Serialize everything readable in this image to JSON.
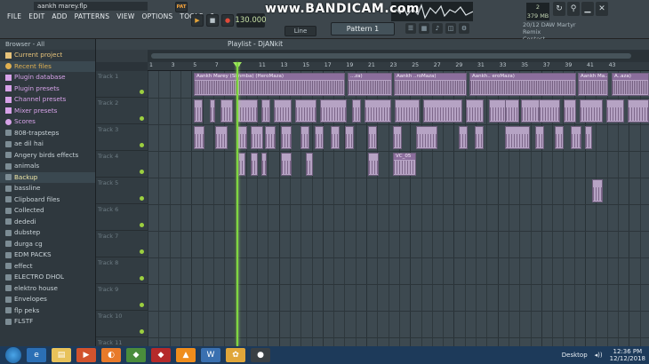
{
  "window": {
    "title": "aankh marey.flp"
  },
  "menu": [
    "FILE",
    "EDIT",
    "ADD",
    "PATTERNS",
    "VIEW",
    "OPTIONS",
    "TOOLS",
    "?"
  ],
  "transport": {
    "pattern_mode": "PAT",
    "tempo": "130.000",
    "pattern": "Pattern 1",
    "snap": "Line"
  },
  "overlay": {
    "watermark": "www.BANDICAM.com"
  },
  "status": {
    "cpu_top": "2",
    "cpu_mem": "379 MB",
    "cpu_bottom": "1"
  },
  "news": {
    "line1": "20/12  DAW Martyr Remix",
    "line2": "Contest"
  },
  "browser": {
    "header": "Browser - All",
    "top_items": [
      "Current project",
      "Recent files",
      "Plugin database",
      "Plugin presets",
      "Channel presets",
      "Mixer presets",
      "Scores"
    ],
    "folders": [
      "808-trapsteps",
      "ae dil hai",
      "Angery birds effects",
      "animals",
      "Backup",
      "bassline",
      "Clipboard files",
      "Collected",
      "dededi",
      "dubstep",
      "durga cg",
      "EDM PACKS",
      "effect",
      "ELECTRO DHOL",
      "elektro house",
      "Envelopes",
      "flp peks",
      "FLSTF"
    ]
  },
  "playlist": {
    "title": "Playlist - DjANkit",
    "ruler": [
      "1",
      "3",
      "5",
      "7",
      "9",
      "11",
      "13",
      "15",
      "17",
      "19",
      "21",
      "23",
      "25",
      "27",
      "29",
      "31",
      "33",
      "35",
      "37",
      "39",
      "41",
      "43"
    ],
    "tracks": [
      "Track 1",
      "Track 2",
      "Track 3",
      "Track 4",
      "Track 5",
      "Track 6",
      "Track 7",
      "Track 8",
      "Track 9",
      "Track 10",
      "Track 11"
    ],
    "clip_labels": [
      "Aankh Marey (Simmba) (HeroMaza)",
      "...za)",
      "Aankh ..roMaza)",
      "Aankh.. eroMaza)",
      "Aankh Ma..(HeroMaza)",
      "A..aza)",
      "VC_05"
    ]
  },
  "taskbar": {
    "desktop_label": "Desktop",
    "time": "12:36 PM",
    "date": "12/12/2018"
  },
  "colors": {
    "clip": "#b6a3c4",
    "playhead": "#7fd63f",
    "grid": "#3d4950"
  }
}
